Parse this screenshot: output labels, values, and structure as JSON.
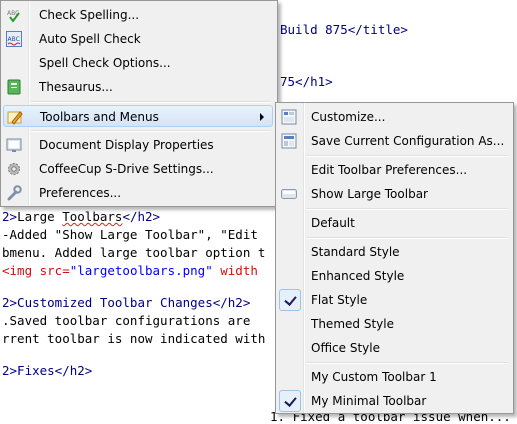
{
  "editor": {
    "lines": {
      "title_tail": "Build 875</title>",
      "h1_tail": "75</h1>",
      "h2_large_open": "2>",
      "h2_large_text": "Large ",
      "h2_large_word": "Toolbars",
      "h2_large_close": "</h2>",
      "added_line": "-Added \"Show Large Toolbar\", \"Edit",
      "submenu_line": "bmenu. Added large toolbar option t",
      "img_open": "<img src=",
      "img_src": "\"largetoolbars.png\"",
      "img_width": " width",
      "customized_line": "2>Customized Toolbar Changes</h2>",
      "saved_line": ".Saved toolbar configurations are",
      "current_line": "rrent toolbar is now indicated with",
      "fixes_line": "2>Fixes</h2>",
      "last_line": "1. Fixed a toolbar issue when..."
    }
  },
  "left_menu": {
    "items": [
      {
        "label": "Check Spelling...",
        "icon": "abc-spell-icon"
      },
      {
        "label": "Auto Spell Check",
        "icon": "abc-auto-spell-icon"
      },
      {
        "label": "Spell Check Options...",
        "icon": ""
      },
      {
        "label": "Thesaurus...",
        "icon": "thesaurus-book-icon"
      },
      {
        "label": "Toolbars and Menus",
        "icon": "toolbar-pencil-icon"
      },
      {
        "label": "Document Display Properties",
        "icon": "display-properties-icon"
      },
      {
        "label": "CoffeeCup S-Drive Settings...",
        "icon": "gear-icon"
      },
      {
        "label": "Preferences...",
        "icon": "wrench-icon"
      }
    ]
  },
  "submenu": {
    "items": [
      {
        "label": "Customize...",
        "icon": "customize-icon"
      },
      {
        "label": "Save Current Configuration As...",
        "icon": "save-config-icon"
      },
      {
        "label": "Edit Toolbar Preferences...",
        "icon": ""
      },
      {
        "label": "Show Large Toolbar",
        "icon": "large-toolbar-icon"
      },
      {
        "label": "Default",
        "icon": ""
      },
      {
        "label": "Standard Style",
        "icon": ""
      },
      {
        "label": "Enhanced Style",
        "icon": ""
      },
      {
        "label": "Flat Style",
        "icon": "",
        "checked": true
      },
      {
        "label": "Themed Style",
        "icon": ""
      },
      {
        "label": "Office Style",
        "icon": ""
      },
      {
        "label": "My Custom Toolbar 1",
        "icon": ""
      },
      {
        "label": "My Minimal Toolbar",
        "icon": "",
        "checked": true
      }
    ]
  },
  "colors": {
    "tag": "#000080",
    "attr": "#d01010",
    "string": "#0000ff",
    "highlight": "#d3e4f7"
  }
}
